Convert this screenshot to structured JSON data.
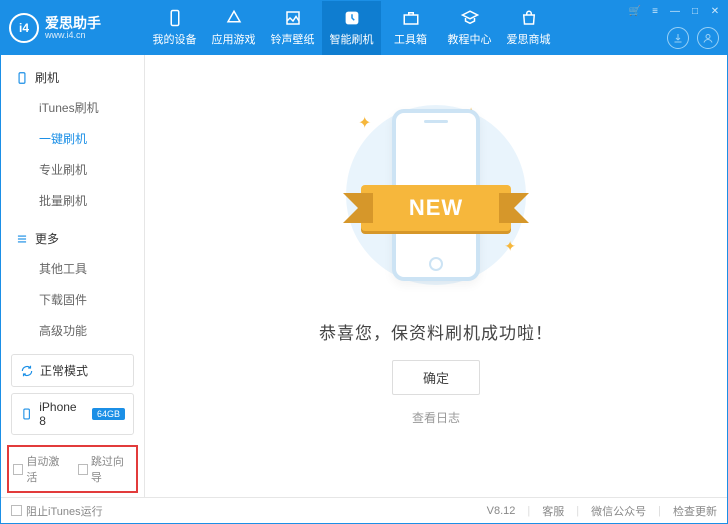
{
  "brand": {
    "title": "爱思助手",
    "subtitle": "www.i4.cn",
    "logo_text": "i4"
  },
  "tabs": [
    {
      "label": "我的设备"
    },
    {
      "label": "应用游戏"
    },
    {
      "label": "铃声壁纸"
    },
    {
      "label": "智能刷机",
      "active": true
    },
    {
      "label": "工具箱"
    },
    {
      "label": "教程中心"
    },
    {
      "label": "爱思商城"
    }
  ],
  "sidebar": {
    "group1": {
      "title": "刷机"
    },
    "items1": [
      {
        "label": "iTunes刷机"
      },
      {
        "label": "一键刷机",
        "active": true
      },
      {
        "label": "专业刷机"
      },
      {
        "label": "批量刷机"
      }
    ],
    "group2": {
      "title": "更多"
    },
    "items2": [
      {
        "label": "其他工具"
      },
      {
        "label": "下载固件"
      },
      {
        "label": "高级功能"
      }
    ],
    "mode": "正常模式",
    "device": "iPhone 8",
    "storage": "64GB",
    "check_auto_activate": "自动激活",
    "check_skip_wizard": "跳过向导"
  },
  "content": {
    "ribbon": "NEW",
    "success": "恭喜您，保资料刷机成功啦！",
    "ok": "确定",
    "view_log": "查看日志"
  },
  "statusbar": {
    "block_itunes": "阻止iTunes运行",
    "version": "V8.12",
    "support": "客服",
    "wechat": "微信公众号",
    "update": "检查更新"
  }
}
